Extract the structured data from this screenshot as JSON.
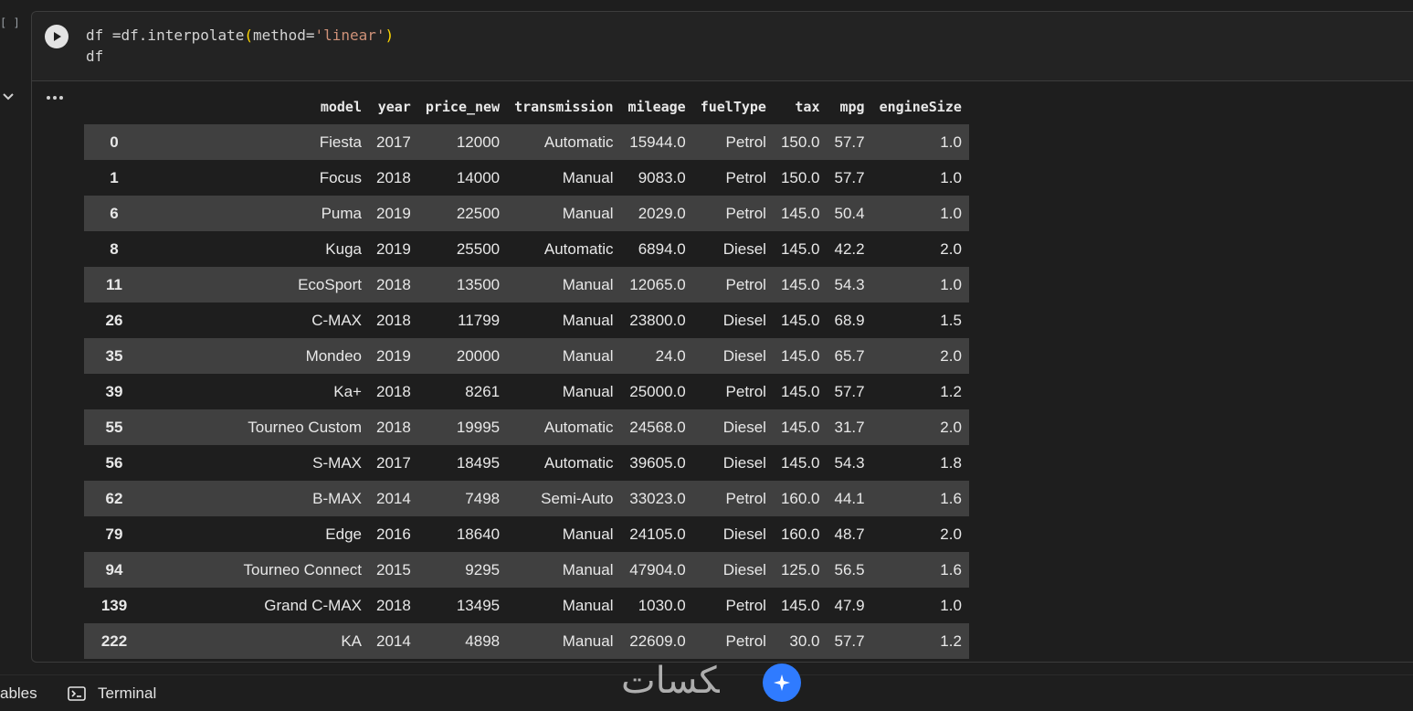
{
  "cell": {
    "exec_count": "[ ]",
    "code_lines": [
      {
        "pre": "df =df.interpolate",
        "paren_open": "(",
        "arg": "method=",
        "str": "'linear'",
        "paren_close": ")"
      },
      {
        "text": "df"
      }
    ]
  },
  "dataframe": {
    "columns": [
      "model",
      "year",
      "price_new",
      "transmission",
      "mileage",
      "fuelType",
      "tax",
      "mpg",
      "engineSize"
    ],
    "rows": [
      [
        "0",
        "Fiesta",
        "2017",
        "12000",
        "Automatic",
        "15944.0",
        "Petrol",
        "150.0",
        "57.7",
        "1.0"
      ],
      [
        "1",
        "Focus",
        "2018",
        "14000",
        "Manual",
        "9083.0",
        "Petrol",
        "150.0",
        "57.7",
        "1.0"
      ],
      [
        "6",
        "Puma",
        "2019",
        "22500",
        "Manual",
        "2029.0",
        "Petrol",
        "145.0",
        "50.4",
        "1.0"
      ],
      [
        "8",
        "Kuga",
        "2019",
        "25500",
        "Automatic",
        "6894.0",
        "Diesel",
        "145.0",
        "42.2",
        "2.0"
      ],
      [
        "11",
        "EcoSport",
        "2018",
        "13500",
        "Manual",
        "12065.0",
        "Petrol",
        "145.0",
        "54.3",
        "1.0"
      ],
      [
        "26",
        "C-MAX",
        "2018",
        "11799",
        "Manual",
        "23800.0",
        "Diesel",
        "145.0",
        "68.9",
        "1.5"
      ],
      [
        "35",
        "Mondeo",
        "2019",
        "20000",
        "Manual",
        "24.0",
        "Diesel",
        "145.0",
        "65.7",
        "2.0"
      ],
      [
        "39",
        "Ka+",
        "2018",
        "8261",
        "Manual",
        "25000.0",
        "Petrol",
        "145.0",
        "57.7",
        "1.2"
      ],
      [
        "55",
        "Tourneo Custom",
        "2018",
        "19995",
        "Automatic",
        "24568.0",
        "Diesel",
        "145.0",
        "31.7",
        "2.0"
      ],
      [
        "56",
        "S-MAX",
        "2017",
        "18495",
        "Automatic",
        "39605.0",
        "Diesel",
        "145.0",
        "54.3",
        "1.8"
      ],
      [
        "62",
        "B-MAX",
        "2014",
        "7498",
        "Semi-Auto",
        "33023.0",
        "Petrol",
        "160.0",
        "44.1",
        "1.6"
      ],
      [
        "79",
        "Edge",
        "2016",
        "18640",
        "Manual",
        "24105.0",
        "Diesel",
        "160.0",
        "48.7",
        "2.0"
      ],
      [
        "94",
        "Tourneo Connect",
        "2015",
        "9295",
        "Manual",
        "47904.0",
        "Diesel",
        "125.0",
        "56.5",
        "1.6"
      ],
      [
        "139",
        "Grand C-MAX",
        "2018",
        "13495",
        "Manual",
        "1030.0",
        "Petrol",
        "145.0",
        "47.9",
        "1.0"
      ],
      [
        "222",
        "KA",
        "2014",
        "4898",
        "Manual",
        "22609.0",
        "Petrol",
        "30.0",
        "57.7",
        "1.2"
      ]
    ]
  },
  "statusbar": {
    "variables_label": "ables",
    "terminal_label": "Terminal"
  },
  "watermark": {
    "text": "ﮑﺴﺎﺕ"
  },
  "icons": {
    "run": "play-icon",
    "collapse": "chevron-down-icon",
    "output_menu": "more-horiz-icon",
    "terminal": "terminal-icon"
  },
  "colors": {
    "background": "#1e1e1e",
    "row_stripe": "#404040",
    "string": "#ce9178",
    "paren": "#ffd700",
    "watermark_badge": "#2f7bff"
  }
}
